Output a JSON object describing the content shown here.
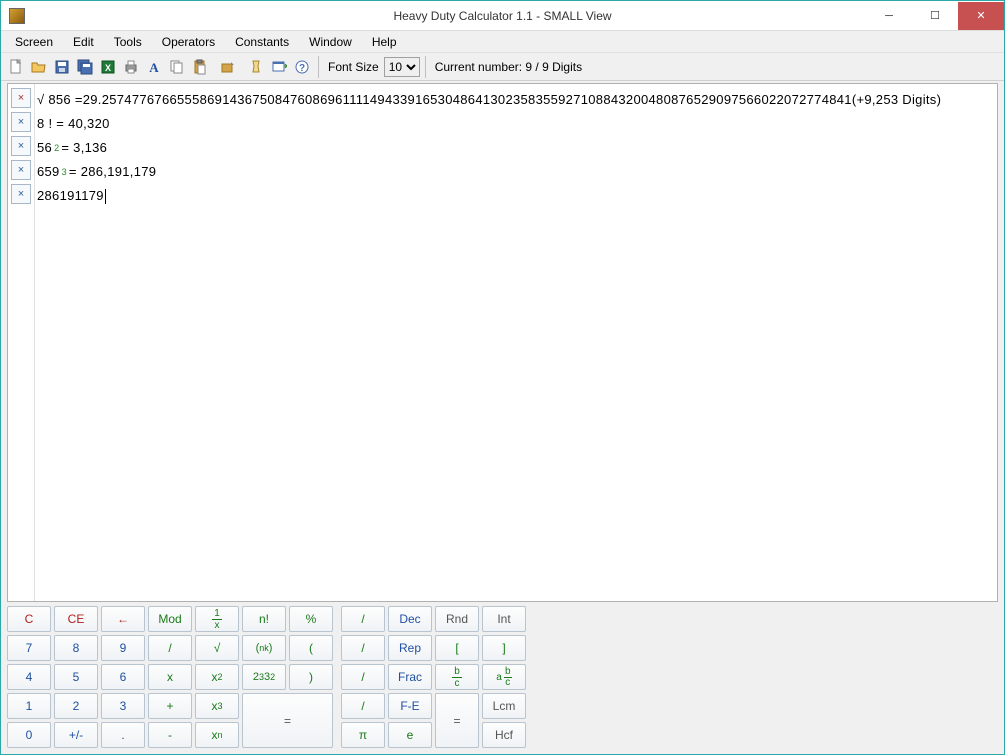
{
  "window": {
    "title": "Heavy Duty Calculator 1.1 - SMALL View"
  },
  "menu": {
    "items": [
      "Screen",
      "Edit",
      "Tools",
      "Operators",
      "Constants",
      "Window",
      "Help"
    ]
  },
  "toolbar": {
    "font_label": "Font Size",
    "font_value": "10",
    "status": "Current number: 9 / 9 Digits"
  },
  "history": {
    "lines": [
      {
        "del_style": "red",
        "prefix": "√ 856 = ",
        "body": "29.2574776766555869143675084760869611114943391653048641302358355927108843200480876529097566022072774841",
        "suffix": " (+9,253 Digits)"
      },
      {
        "del_style": "blue",
        "body": "8 ! = 40,320"
      },
      {
        "del_style": "blue",
        "base": "56",
        "exp": "2",
        "rest": " = 3,136"
      },
      {
        "del_style": "blue",
        "base": "659",
        "exp": "3",
        "rest": " = 286,191,179"
      },
      {
        "del_style": "blue",
        "body": "286191179",
        "cursor": true
      }
    ]
  },
  "keypad": {
    "left": {
      "row1": [
        "C",
        "CE",
        "←",
        "Mod",
        "1/x",
        "n!",
        "%"
      ],
      "row2": [
        "7",
        "8",
        "9",
        "/",
        "√",
        "(n k)",
        "("
      ],
      "row3": [
        "4",
        "5",
        "6",
        "x",
        "x²",
        "2³3²",
        ")"
      ],
      "row4": [
        "1",
        "2",
        "3",
        "+",
        "x³",
        "=",
        ""
      ],
      "row5": [
        "0",
        "+/-",
        ".",
        "-",
        "xⁿ",
        "",
        ""
      ]
    },
    "right": {
      "row1": [
        "/",
        "Dec",
        "Rnd",
        "Int"
      ],
      "row2": [
        "/",
        "Rep",
        "[",
        "]"
      ],
      "row3": [
        "/",
        "Frac",
        "b/c",
        "a b/c"
      ],
      "row4": [
        "/",
        "F-E",
        "=",
        "Lcm"
      ],
      "row5": [
        "π",
        "e",
        "",
        "Hcf"
      ]
    }
  }
}
